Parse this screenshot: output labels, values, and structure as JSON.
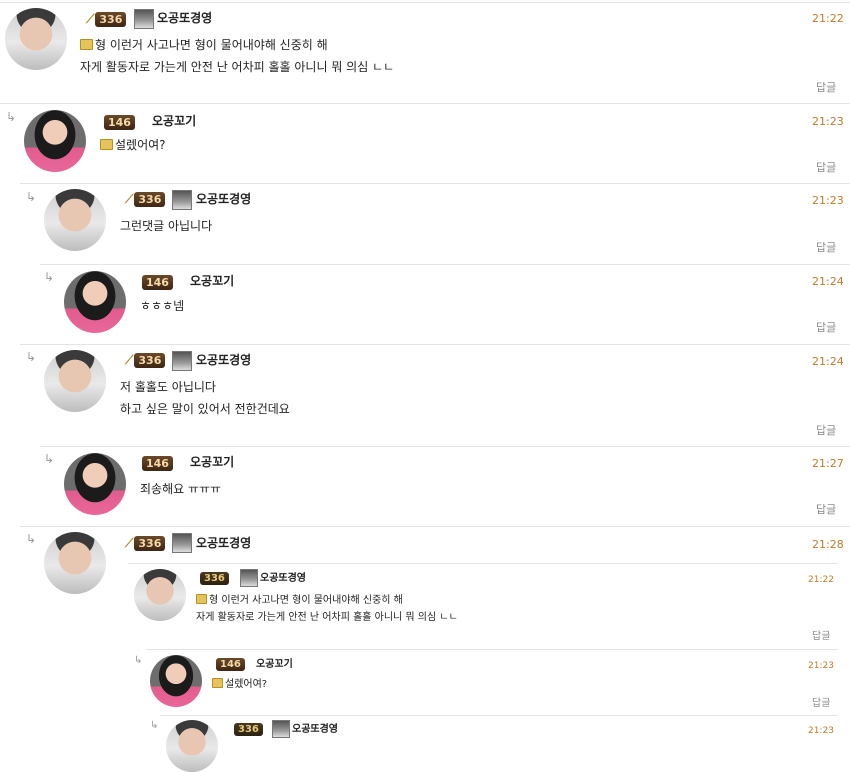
{
  "c1": {
    "rank": "336",
    "nick": "오공또경영",
    "time": "21:22",
    "line1": "형 이런거 사고나면 형이 물어내야해 신중히 해",
    "line2": "자게 활동자로 가는게 안전 난 어차피 홀홀 아니니 뭐 의심 ㄴㄴ",
    "reply": "답글"
  },
  "c2": {
    "rank": "146",
    "nick": "오공꼬기",
    "time": "21:23",
    "line1": "설렜어여?",
    "reply": "답글"
  },
  "c3": {
    "rank": "336",
    "nick": "오공또경영",
    "time": "21:23",
    "line1": "그런댓글 아닙니다",
    "reply": "답글"
  },
  "c4": {
    "rank": "146",
    "nick": "오공꼬기",
    "time": "21:24",
    "line1": "ㅎㅎㅎ넴",
    "reply": "답글"
  },
  "c5": {
    "rank": "336",
    "nick": "오공또경영",
    "time": "21:24",
    "line1": "저 홀홀도 아닙니다",
    "line2": "하고 싶은 말이 있어서 전한건데요",
    "reply": "답글"
  },
  "c6": {
    "rank": "146",
    "nick": "오공꼬기",
    "time": "21:27",
    "line1": "죄송해요 ㅠㅠㅠ"
  },
  "c7": {
    "rank": "336",
    "nick": "오공또경영",
    "time": "21:28"
  },
  "q1": {
    "rank": "336",
    "nick": "오공또경영",
    "time": "21:22",
    "line1": "형 이런거 사고나면 형이 물어내야해 신중히 해",
    "line2": "자게 활동자로 가는게 안전 난 어차피 홀홀 아니니 뭐 의심 ㄴㄴ",
    "reply": "답글"
  },
  "q2": {
    "rank": "146",
    "nick": "오공꼬기",
    "time": "21:23",
    "line1": "설렜어여?",
    "reply": "답글"
  },
  "q3": {
    "rank": "336",
    "nick": "오공또경영",
    "time": "21:23"
  },
  "c6_reply": "답글"
}
